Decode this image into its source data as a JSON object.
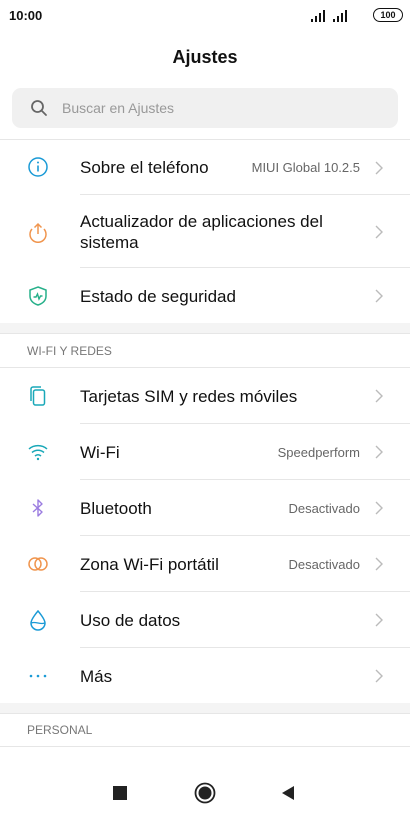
{
  "status_bar": {
    "time": "10:00",
    "battery": "100"
  },
  "header": {
    "title": "Ajustes"
  },
  "search": {
    "placeholder": "Buscar en Ajustes"
  },
  "colors": {
    "info": "#1a9ad6",
    "updater": "#f0954e",
    "security": "#27b08a",
    "sim": "#19a8b8",
    "wifi": "#19a8b8",
    "bluetooth": "#9b7ce0",
    "hotspot": "#f0954e",
    "data": "#1a9ad6",
    "more": "#1a9ad6"
  },
  "items_top": [
    {
      "icon": "info-icon",
      "label": "Sobre el teléfono",
      "value": "MIUI Global 10.2.5"
    },
    {
      "icon": "updater-icon",
      "label": "Actualizador de aplicaciones del sistema",
      "value": ""
    },
    {
      "icon": "shield-icon",
      "label": "Estado de seguridad",
      "value": ""
    }
  ],
  "section_network": {
    "header": "WI-FI Y REDES",
    "items": [
      {
        "icon": "sim-icon",
        "label": "Tarjetas SIM y redes móviles",
        "value": ""
      },
      {
        "icon": "wifi-icon",
        "label": "Wi-Fi",
        "value": "Speedperform"
      },
      {
        "icon": "bluetooth-icon",
        "label": "Bluetooth",
        "value": "Desactivado"
      },
      {
        "icon": "hotspot-icon",
        "label": "Zona Wi-Fi portátil",
        "value": "Desactivado"
      },
      {
        "icon": "data-usage-icon",
        "label": "Uso de datos",
        "value": ""
      },
      {
        "icon": "more-icon",
        "label": "Más",
        "value": ""
      }
    ]
  },
  "section_personal": {
    "header": "PERSONAL"
  },
  "nav": {
    "recent": "recent-apps-icon",
    "home": "home-icon",
    "back": "back-icon"
  }
}
